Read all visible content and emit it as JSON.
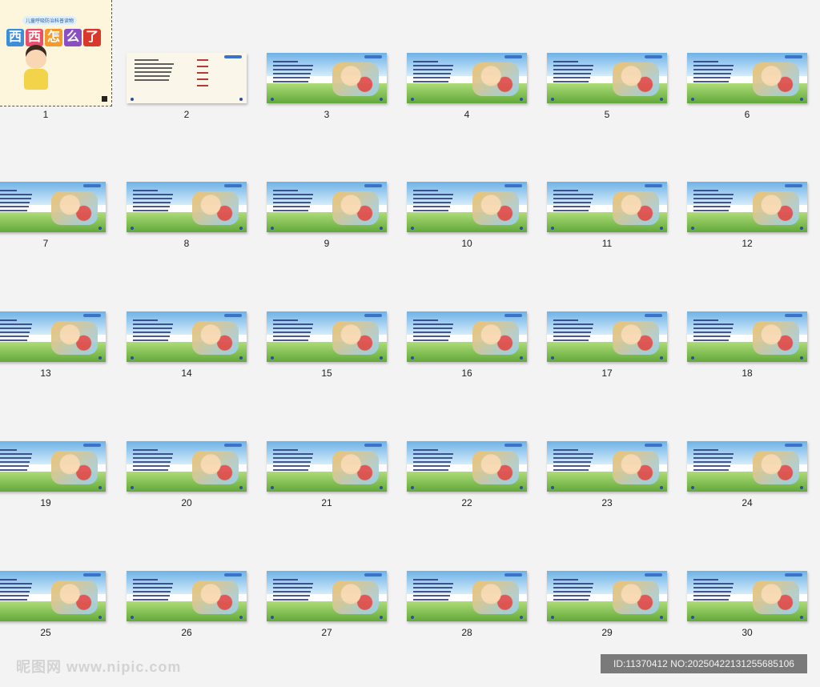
{
  "cover": {
    "subtitle": "儿童呼吸防治科普读物",
    "title_chars": [
      "西",
      "西",
      "怎",
      "么",
      "了"
    ],
    "title_colors": [
      "#3b8ed8",
      "#e94f6a",
      "#f29a2e",
      "#8b4fc4",
      "#d8392b"
    ],
    "number": "1"
  },
  "slides": [
    {
      "n": "2",
      "kind": "toc"
    },
    {
      "n": "3"
    },
    {
      "n": "4"
    },
    {
      "n": "5"
    },
    {
      "n": "6"
    },
    {
      "n": "7"
    },
    {
      "n": "8"
    },
    {
      "n": "9"
    },
    {
      "n": "10"
    },
    {
      "n": "11"
    },
    {
      "n": "12"
    },
    {
      "n": "13"
    },
    {
      "n": "14"
    },
    {
      "n": "15"
    },
    {
      "n": "16"
    },
    {
      "n": "17"
    },
    {
      "n": "18"
    },
    {
      "n": "19"
    },
    {
      "n": "20"
    },
    {
      "n": "21"
    },
    {
      "n": "22"
    },
    {
      "n": "23"
    },
    {
      "n": "24"
    },
    {
      "n": "25"
    },
    {
      "n": "26"
    },
    {
      "n": "27"
    },
    {
      "n": "28"
    },
    {
      "n": "29"
    },
    {
      "n": "30"
    }
  ],
  "footer": {
    "watermark": "昵图网 www.nipic.com",
    "id_text": "ID:11370412 NO:20250422131255685106"
  }
}
